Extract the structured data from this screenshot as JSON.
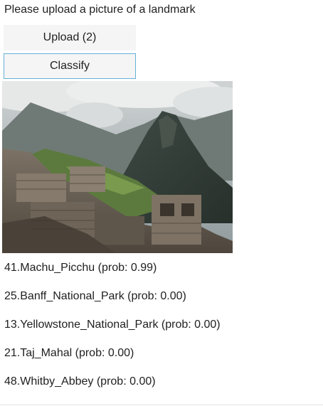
{
  "prompt_text": "Please upload a picture of a landmark",
  "upload_button_label": "Upload (2)",
  "classify_button_label": "Classify",
  "photo_subject": "mountain-ruins-landscape-photo",
  "results": [
    "41.Machu_Picchu (prob: 0.99)",
    "25.Banff_National_Park (prob: 0.00)",
    "13.Yellowstone_National_Park (prob: 0.00)",
    "21.Taj_Mahal (prob: 0.00)",
    "48.Whitby_Abbey (prob: 0.00)"
  ],
  "colors": {
    "button_bg": "#f5f5f5",
    "focus_border": "#64b1d6",
    "text": "#1f1f1f"
  }
}
